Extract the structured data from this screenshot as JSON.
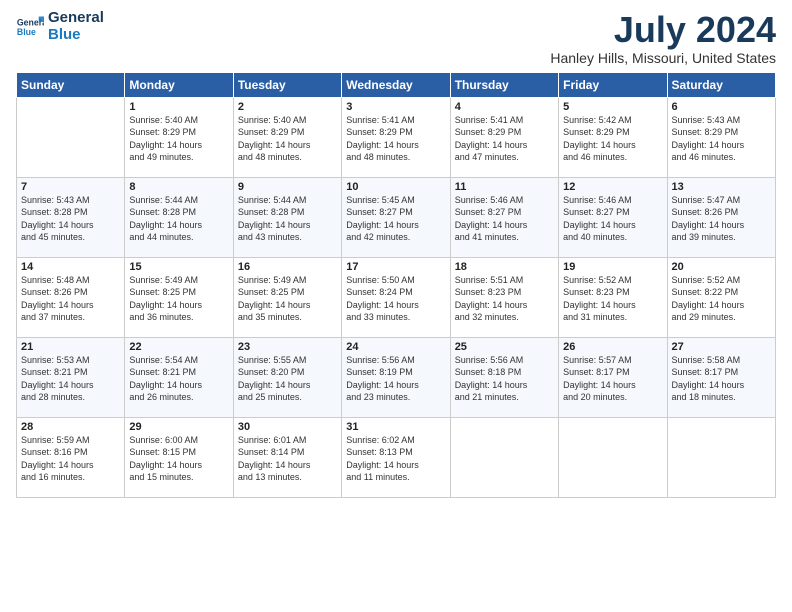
{
  "header": {
    "logo_line1": "General",
    "logo_line2": "Blue",
    "title": "July 2024",
    "subtitle": "Hanley Hills, Missouri, United States"
  },
  "calendar": {
    "days_of_week": [
      "Sunday",
      "Monday",
      "Tuesday",
      "Wednesday",
      "Thursday",
      "Friday",
      "Saturday"
    ],
    "weeks": [
      [
        {
          "day": "",
          "info": ""
        },
        {
          "day": "1",
          "info": "Sunrise: 5:40 AM\nSunset: 8:29 PM\nDaylight: 14 hours\nand 49 minutes."
        },
        {
          "day": "2",
          "info": "Sunrise: 5:40 AM\nSunset: 8:29 PM\nDaylight: 14 hours\nand 48 minutes."
        },
        {
          "day": "3",
          "info": "Sunrise: 5:41 AM\nSunset: 8:29 PM\nDaylight: 14 hours\nand 48 minutes."
        },
        {
          "day": "4",
          "info": "Sunrise: 5:41 AM\nSunset: 8:29 PM\nDaylight: 14 hours\nand 47 minutes."
        },
        {
          "day": "5",
          "info": "Sunrise: 5:42 AM\nSunset: 8:29 PM\nDaylight: 14 hours\nand 46 minutes."
        },
        {
          "day": "6",
          "info": "Sunrise: 5:43 AM\nSunset: 8:29 PM\nDaylight: 14 hours\nand 46 minutes."
        }
      ],
      [
        {
          "day": "7",
          "info": "Sunrise: 5:43 AM\nSunset: 8:28 PM\nDaylight: 14 hours\nand 45 minutes."
        },
        {
          "day": "8",
          "info": "Sunrise: 5:44 AM\nSunset: 8:28 PM\nDaylight: 14 hours\nand 44 minutes."
        },
        {
          "day": "9",
          "info": "Sunrise: 5:44 AM\nSunset: 8:28 PM\nDaylight: 14 hours\nand 43 minutes."
        },
        {
          "day": "10",
          "info": "Sunrise: 5:45 AM\nSunset: 8:27 PM\nDaylight: 14 hours\nand 42 minutes."
        },
        {
          "day": "11",
          "info": "Sunrise: 5:46 AM\nSunset: 8:27 PM\nDaylight: 14 hours\nand 41 minutes."
        },
        {
          "day": "12",
          "info": "Sunrise: 5:46 AM\nSunset: 8:27 PM\nDaylight: 14 hours\nand 40 minutes."
        },
        {
          "day": "13",
          "info": "Sunrise: 5:47 AM\nSunset: 8:26 PM\nDaylight: 14 hours\nand 39 minutes."
        }
      ],
      [
        {
          "day": "14",
          "info": "Sunrise: 5:48 AM\nSunset: 8:26 PM\nDaylight: 14 hours\nand 37 minutes."
        },
        {
          "day": "15",
          "info": "Sunrise: 5:49 AM\nSunset: 8:25 PM\nDaylight: 14 hours\nand 36 minutes."
        },
        {
          "day": "16",
          "info": "Sunrise: 5:49 AM\nSunset: 8:25 PM\nDaylight: 14 hours\nand 35 minutes."
        },
        {
          "day": "17",
          "info": "Sunrise: 5:50 AM\nSunset: 8:24 PM\nDaylight: 14 hours\nand 33 minutes."
        },
        {
          "day": "18",
          "info": "Sunrise: 5:51 AM\nSunset: 8:23 PM\nDaylight: 14 hours\nand 32 minutes."
        },
        {
          "day": "19",
          "info": "Sunrise: 5:52 AM\nSunset: 8:23 PM\nDaylight: 14 hours\nand 31 minutes."
        },
        {
          "day": "20",
          "info": "Sunrise: 5:52 AM\nSunset: 8:22 PM\nDaylight: 14 hours\nand 29 minutes."
        }
      ],
      [
        {
          "day": "21",
          "info": "Sunrise: 5:53 AM\nSunset: 8:21 PM\nDaylight: 14 hours\nand 28 minutes."
        },
        {
          "day": "22",
          "info": "Sunrise: 5:54 AM\nSunset: 8:21 PM\nDaylight: 14 hours\nand 26 minutes."
        },
        {
          "day": "23",
          "info": "Sunrise: 5:55 AM\nSunset: 8:20 PM\nDaylight: 14 hours\nand 25 minutes."
        },
        {
          "day": "24",
          "info": "Sunrise: 5:56 AM\nSunset: 8:19 PM\nDaylight: 14 hours\nand 23 minutes."
        },
        {
          "day": "25",
          "info": "Sunrise: 5:56 AM\nSunset: 8:18 PM\nDaylight: 14 hours\nand 21 minutes."
        },
        {
          "day": "26",
          "info": "Sunrise: 5:57 AM\nSunset: 8:17 PM\nDaylight: 14 hours\nand 20 minutes."
        },
        {
          "day": "27",
          "info": "Sunrise: 5:58 AM\nSunset: 8:17 PM\nDaylight: 14 hours\nand 18 minutes."
        }
      ],
      [
        {
          "day": "28",
          "info": "Sunrise: 5:59 AM\nSunset: 8:16 PM\nDaylight: 14 hours\nand 16 minutes."
        },
        {
          "day": "29",
          "info": "Sunrise: 6:00 AM\nSunset: 8:15 PM\nDaylight: 14 hours\nand 15 minutes."
        },
        {
          "day": "30",
          "info": "Sunrise: 6:01 AM\nSunset: 8:14 PM\nDaylight: 14 hours\nand 13 minutes."
        },
        {
          "day": "31",
          "info": "Sunrise: 6:02 AM\nSunset: 8:13 PM\nDaylight: 14 hours\nand 11 minutes."
        },
        {
          "day": "",
          "info": ""
        },
        {
          "day": "",
          "info": ""
        },
        {
          "day": "",
          "info": ""
        }
      ]
    ]
  }
}
